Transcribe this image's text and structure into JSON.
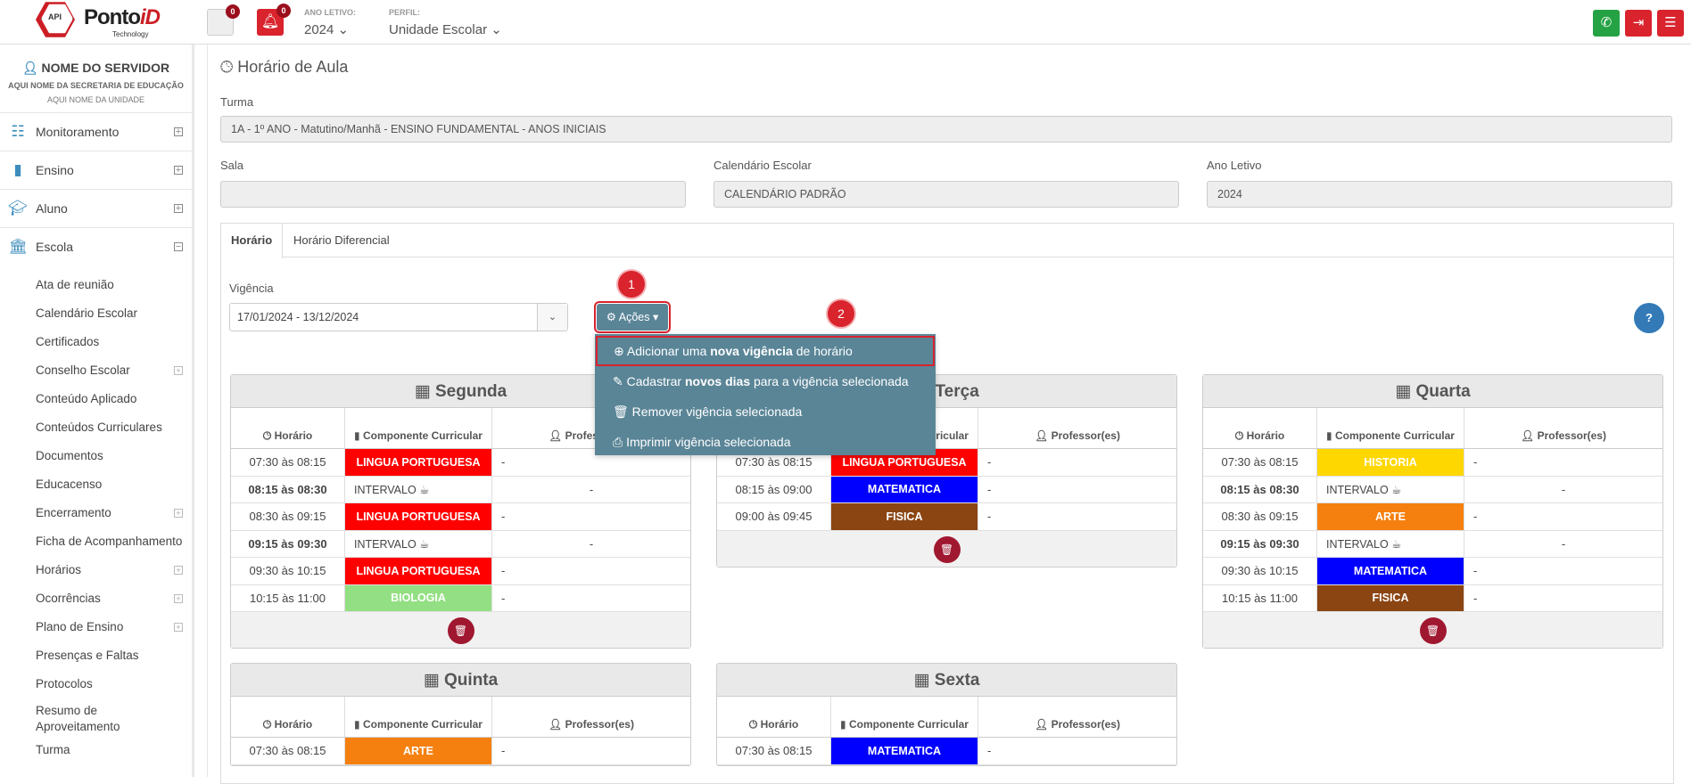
{
  "header": {
    "logo_api": "API",
    "logo_brand_a": "Ponto",
    "logo_brand_b": "iD",
    "logo_tech": "Technology",
    "notif_badge": "0",
    "alert_badge": "0",
    "ano_letivo_label": "ANO LETIVO:",
    "ano_letivo_value": "2024 ⌄",
    "perfil_label": "PERFIL:",
    "perfil_value": "Unidade Escolar ⌄",
    "colors": {
      "whatsapp": "#25a244",
      "logout": "#d9232d",
      "menu": "#d9232d"
    }
  },
  "sidebar": {
    "user_name": "NOME DO SERVIDOR",
    "secretaria": "AQUI NOME DA SECRETARIA DE EDUCAÇÃO",
    "unidade": "AQUI NOME DA UNIDADE",
    "items": [
      {
        "label": "Monitoramento",
        "icon": "sliders-icon",
        "toggle": "⊞"
      },
      {
        "label": "Ensino",
        "icon": "book-icon",
        "toggle": "⊞"
      },
      {
        "label": "Aluno",
        "icon": "graduation-cap-icon",
        "toggle": "⊞"
      },
      {
        "label": "Escola",
        "icon": "bank-icon",
        "toggle": "⊟"
      }
    ],
    "subitems": [
      {
        "label": "Ata de reunião"
      },
      {
        "label": "Calendário Escolar"
      },
      {
        "label": "Certificados"
      },
      {
        "label": "Conselho Escolar"
      },
      {
        "label": "Conteúdo Aplicado"
      },
      {
        "label": "Conteúdos Curriculares"
      },
      {
        "label": "Documentos"
      },
      {
        "label": "Educacenso"
      },
      {
        "label": "Encerramento"
      },
      {
        "label": "Ficha de Acompanhamento"
      },
      {
        "label": "Horários"
      },
      {
        "label": "Ocorrências"
      },
      {
        "label": "Plano de Ensino"
      },
      {
        "label": "Presenças e Faltas"
      },
      {
        "label": "Protocolos"
      },
      {
        "label": "Resumo de Aproveitamento"
      },
      {
        "label": "Turma"
      }
    ]
  },
  "main": {
    "title": "Horário de Aula",
    "turma_label": "Turma",
    "turma_value": "1A - 1º ANO - Matutino/Manhã - ENSINO FUNDAMENTAL - ANOS INICIAIS",
    "sala_label": "Sala",
    "sala_value": "",
    "calendario_label": "Calendário Escolar",
    "calendario_value": "CALENDÁRIO PADRÃO",
    "ano_label": "Ano Letivo",
    "ano_value": "2024",
    "tabs": [
      {
        "label": "Horário"
      },
      {
        "label": "Horário Diferencial"
      }
    ],
    "vigencia_label": "Vigência",
    "vigencia_value": "17/01/2024 - 13/12/2024",
    "acoes_label": "Ações ▾",
    "help_label": "?",
    "step1": "1",
    "step2": "2",
    "dropdown": {
      "item1_pre": "Adicionar uma ",
      "item1_bold": "nova vigência",
      "item1_post": " de horário",
      "item2_pre": "Cadastrar ",
      "item2_bold": "novos dias",
      "item2_post": " para a vigência selecionada",
      "item3": "Remover vigência selecionada",
      "item4": "Imprimir vigência selecionada"
    }
  },
  "table_headers": {
    "horario": "Horário",
    "componente": "Componente Curricular",
    "professor": "Professor(es)"
  },
  "days": {
    "segunda": {
      "name": "Segunda",
      "rows": [
        {
          "time": "07:30 às 08:15",
          "comp": "LINGUA PORTUGUESA",
          "color": "#ff0000",
          "text": "#ffffff",
          "prof": "-"
        },
        {
          "time": "08:15 às 08:30",
          "comp": "INTERVALO ☕",
          "interval": true,
          "prof": "-"
        },
        {
          "time": "08:30 às 09:15",
          "comp": "LINGUA PORTUGUESA",
          "color": "#ff0000",
          "text": "#ffffff",
          "prof": "-"
        },
        {
          "time": "09:15 às 09:30",
          "comp": "INTERVALO ☕",
          "interval": true,
          "prof": "-"
        },
        {
          "time": "09:30 às 10:15",
          "comp": "LINGUA PORTUGUESA",
          "color": "#ff0000",
          "text": "#ffffff",
          "prof": "-"
        },
        {
          "time": "10:15 às 11:00",
          "comp": "BIOLOGIA",
          "color": "#93df83",
          "text": "#ffffff",
          "prof": "-"
        }
      ]
    },
    "terca": {
      "name": "Terça",
      "rows": [
        {
          "time": "07:30 às 08:15",
          "comp": "LINGUA PORTUGUESA",
          "color": "#ff0000",
          "text": "#ffffff",
          "prof": "-"
        },
        {
          "time": "08:15 às 09:00",
          "comp": "MATEMATICA",
          "color": "#0000ff",
          "text": "#ffffff",
          "prof": "-"
        },
        {
          "time": "09:00 às 09:45",
          "comp": "FISICA",
          "color": "#8b4513",
          "text": "#ffffff",
          "prof": "-"
        }
      ]
    },
    "quarta": {
      "name": "Quarta",
      "rows": [
        {
          "time": "07:30 às 08:15",
          "comp": "HISTORIA",
          "color": "#ffd700",
          "text": "#ffffff",
          "prof": "-"
        },
        {
          "time": "08:15 às 08:30",
          "comp": "INTERVALO ☕",
          "interval": true,
          "prof": "-"
        },
        {
          "time": "08:30 às 09:15",
          "comp": "ARTE",
          "color": "#f5800f",
          "text": "#ffffff",
          "prof": "-"
        },
        {
          "time": "09:15 às 09:30",
          "comp": "INTERVALO ☕",
          "interval": true,
          "prof": "-"
        },
        {
          "time": "09:30 às 10:15",
          "comp": "MATEMATICA",
          "color": "#0000ff",
          "text": "#ffffff",
          "prof": "-"
        },
        {
          "time": "10:15 às 11:00",
          "comp": "FISICA",
          "color": "#8b4513",
          "text": "#ffffff",
          "prof": "-"
        }
      ]
    },
    "quinta": {
      "name": "Quinta",
      "rows": [
        {
          "time": "07:30 às 08:15",
          "comp": "ARTE",
          "color": "#f5800f",
          "text": "#ffffff",
          "prof": "-"
        }
      ]
    },
    "sexta": {
      "name": "Sexta",
      "rows": [
        {
          "time": "07:30 às 08:15",
          "comp": "MATEMATICA",
          "color": "#0000ff",
          "text": "#ffffff",
          "prof": "-"
        }
      ]
    }
  }
}
